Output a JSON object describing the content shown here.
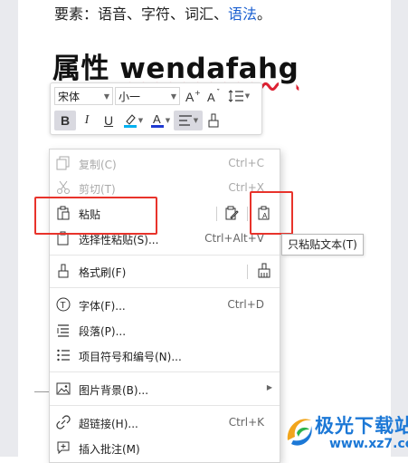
{
  "document": {
    "line1_prefix": "要素：语音、字符、词汇、",
    "line1_link": "语法",
    "line1_suffix": "。",
    "title_cn": "属性 ",
    "title_en": "wendafahg"
  },
  "mini_toolbar": {
    "font_name": "宋体",
    "font_size": "小一",
    "bold": "B",
    "italic": "I",
    "underline": "U",
    "font_color_label": "A",
    "highlight_color": "#00b0f0",
    "font_color": "#1f3ad1"
  },
  "context_menu": {
    "items": [
      {
        "label": "复制(C)",
        "shortcut": "Ctrl+C",
        "icon": "copy-icon",
        "disabled": true
      },
      {
        "label": "剪切(T)",
        "shortcut": "Ctrl+X",
        "icon": "scissors-icon",
        "disabled": true
      },
      {
        "label": "粘贴",
        "shortcut": "",
        "icon": "paste-icon",
        "disabled": false
      },
      {
        "label": "选择性粘贴(S)...",
        "shortcut": "Ctrl+Alt+V",
        "icon": "paste-special-icon",
        "disabled": false
      },
      {
        "label": "格式刷(F)",
        "shortcut": "",
        "icon": "format-painter-icon",
        "disabled": false
      },
      {
        "label": "字体(F)...",
        "shortcut": "Ctrl+D",
        "icon": "font-icon",
        "disabled": false
      },
      {
        "label": "段落(P)...",
        "shortcut": "",
        "icon": "paragraph-icon",
        "disabled": false
      },
      {
        "label": "项目符号和编号(N)...",
        "shortcut": "",
        "icon": "bullets-icon",
        "disabled": false
      },
      {
        "label": "图片背景(B)...",
        "shortcut": "",
        "icon": "picture-icon",
        "disabled": false
      },
      {
        "label": "超链接(H)...",
        "shortcut": "Ctrl+K",
        "icon": "link-icon",
        "disabled": false
      },
      {
        "label": "插入批注(M)",
        "shortcut": "",
        "icon": "comment-icon",
        "disabled": false
      }
    ]
  },
  "tooltip": {
    "text": "只粘贴文本(T)"
  },
  "watermark": {
    "line1": "极光下载站",
    "line2": "www.xz7.com"
  },
  "colors": {
    "annotation_red": "#e8332b",
    "link_blue": "#1a5fd0"
  }
}
